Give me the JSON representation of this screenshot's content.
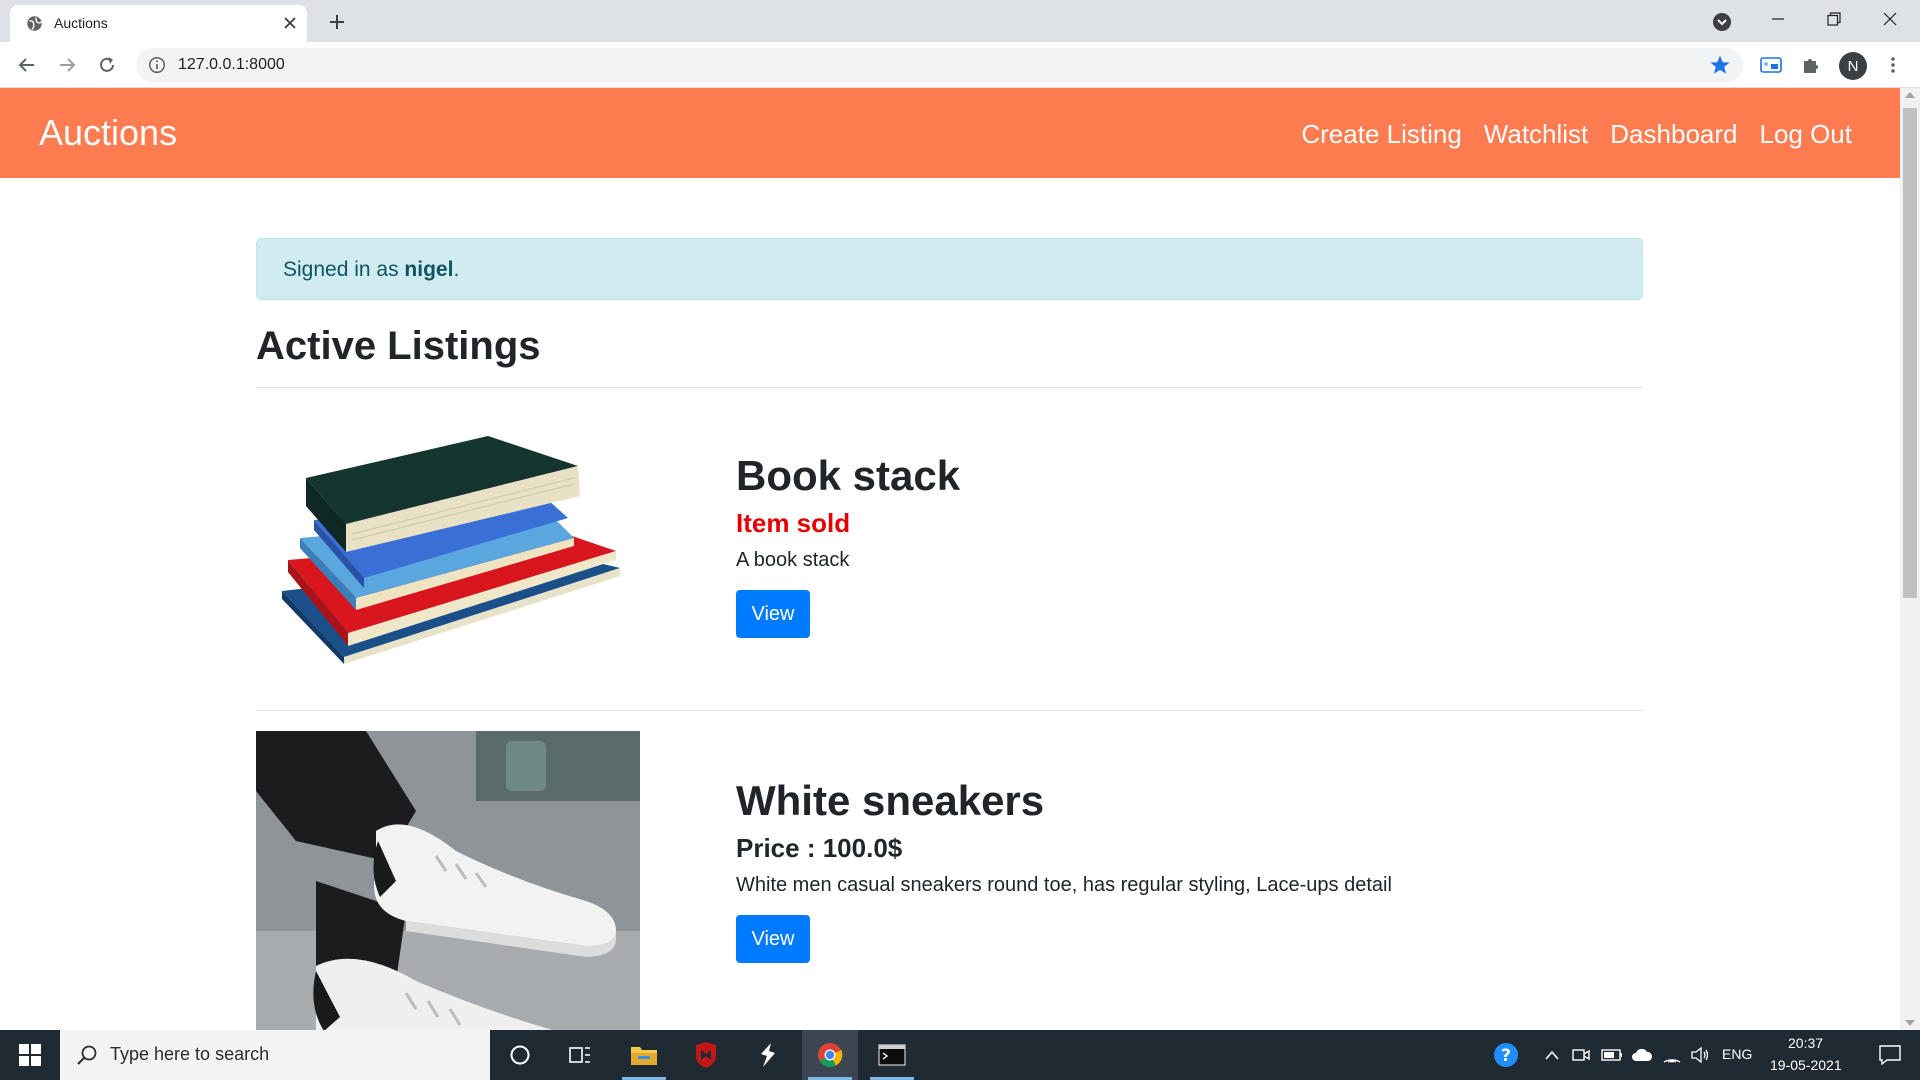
{
  "browser": {
    "tab_title": "Auctions",
    "url": "127.0.0.1:8000",
    "profile_initial": "N"
  },
  "site": {
    "brand": "Auctions",
    "nav": [
      "Create Listing",
      "Watchlist",
      "Dashboard",
      "Log Out"
    ],
    "alert_prefix": "Signed in as ",
    "alert_user": "nigel",
    "alert_suffix": ".",
    "heading": "Active Listings",
    "listings": [
      {
        "title": "Book stack",
        "status": "Item sold",
        "status_color": "#e50000",
        "description": "A book stack",
        "button": "View"
      },
      {
        "title": "White sneakers",
        "status": "Price : 100.0$",
        "status_color": "#212529",
        "description": "White men casual sneakers round toe, has regular styling, Lace-ups detail",
        "button": "View"
      }
    ]
  },
  "taskbar": {
    "search_placeholder": "Type here to search",
    "language": "ENG",
    "time": "20:37",
    "date": "19-05-2021"
  },
  "colors": {
    "navbar": "#ff7b50",
    "primary_button": "#007bff",
    "alert_background": "#d1ecf1"
  }
}
